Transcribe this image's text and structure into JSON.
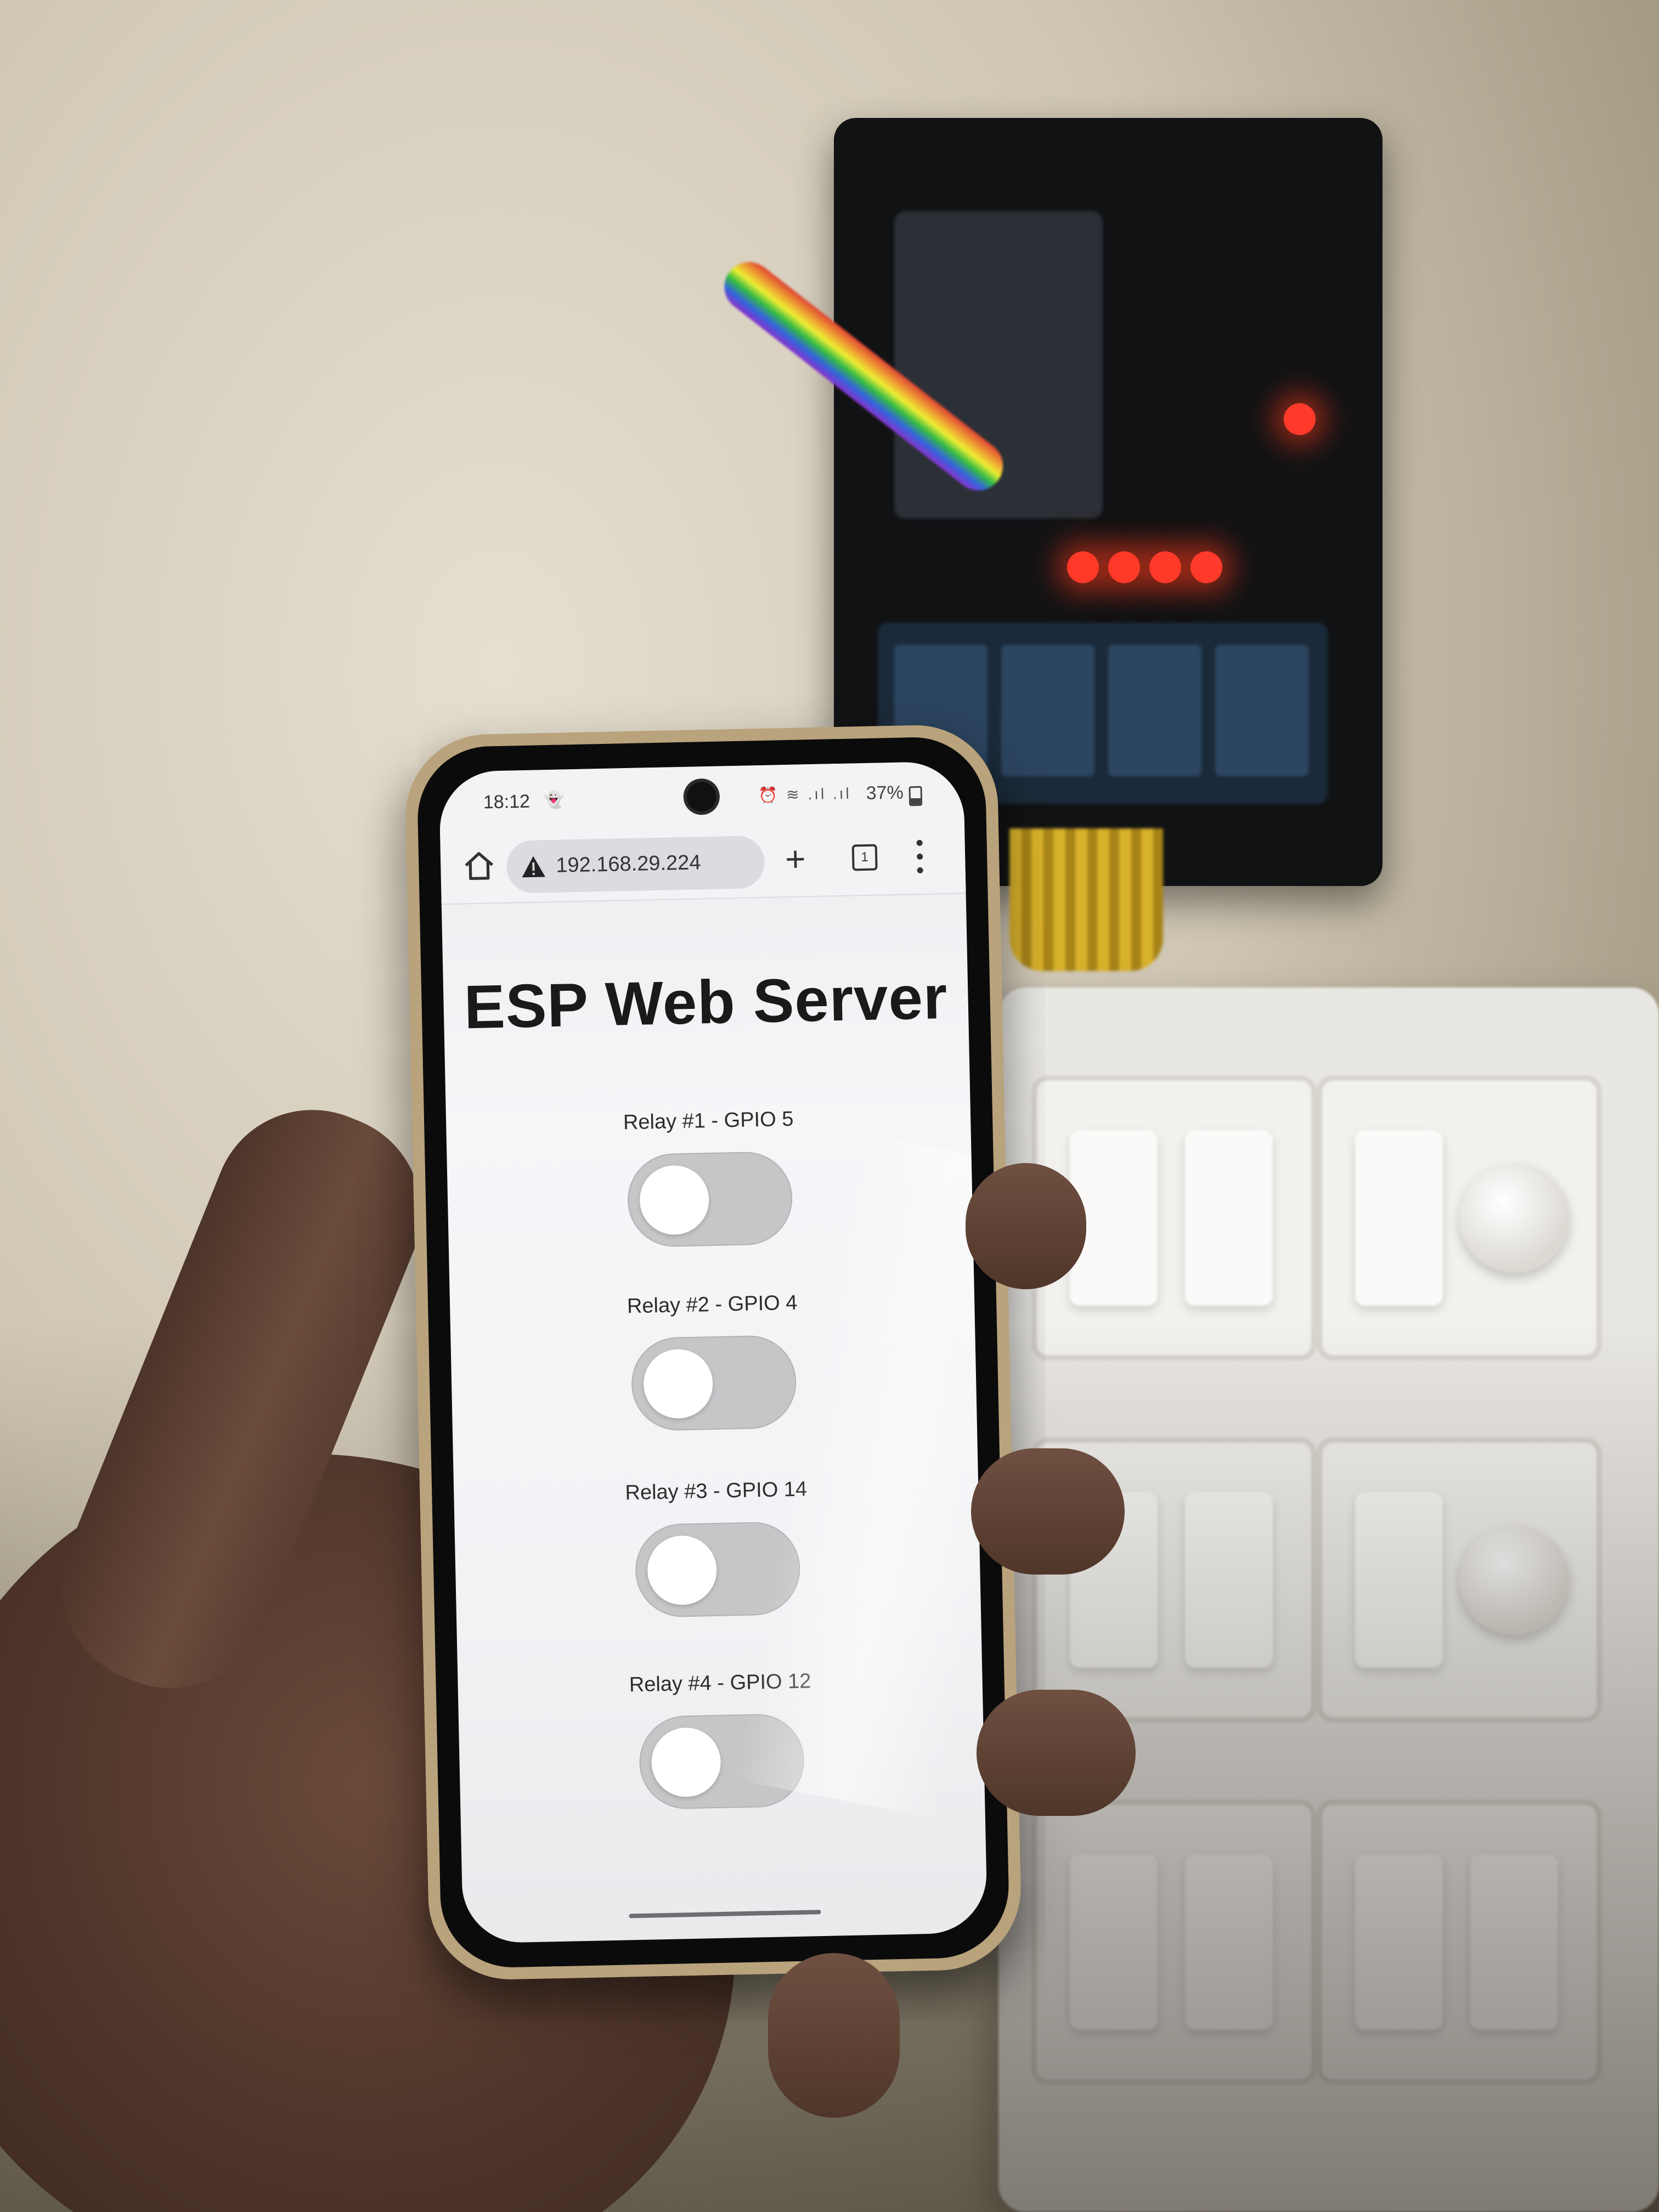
{
  "status_bar": {
    "time": "18:12",
    "notification_icon": "snapchat-ghost-icon",
    "status_icons": "⏰ ≋ .ıl .ıl",
    "battery": "37%",
    "battery_level": 0.37
  },
  "browser": {
    "url": "192.168.29.224",
    "tab_count": "1",
    "icons": [
      "home-icon",
      "warning-icon",
      "plus-icon",
      "tabs-icon",
      "more-vert-icon"
    ]
  },
  "page": {
    "title": "ESP Web Server",
    "relays": [
      {
        "label": "Relay #1 - GPIO 5",
        "state": "off"
      },
      {
        "label": "Relay #2 - GPIO 4",
        "state": "off"
      },
      {
        "label": "Relay #3 - GPIO 14",
        "state": "off"
      },
      {
        "label": "Relay #4 - GPIO 12",
        "state": "off"
      }
    ]
  },
  "colors": {
    "toggle_off": "#c6c5c8",
    "toggle_knob": "#ffffff",
    "title_text": "#1a1a1a",
    "url_pill": "#dcdbe2",
    "led_red": "#ff3a2a"
  }
}
